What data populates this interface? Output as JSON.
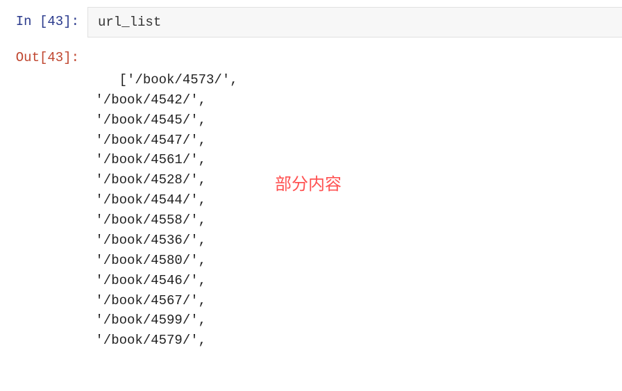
{
  "input_cell": {
    "execution_count": 43,
    "prompt_label": "In [43]:",
    "code": "url_list"
  },
  "output_cell": {
    "execution_count": 43,
    "prompt_label": "Out[43]:",
    "items": [
      "'/book/4573/'",
      "'/book/4542/'",
      "'/book/4545/'",
      "'/book/4547/'",
      "'/book/4561/'",
      "'/book/4528/'",
      "'/book/4544/'",
      "'/book/4558/'",
      "'/book/4536/'",
      "'/book/4580/'",
      "'/book/4546/'",
      "'/book/4567/'",
      "'/book/4599/'",
      "'/book/4579/'"
    ]
  },
  "annotation": {
    "text": "部分内容"
  }
}
